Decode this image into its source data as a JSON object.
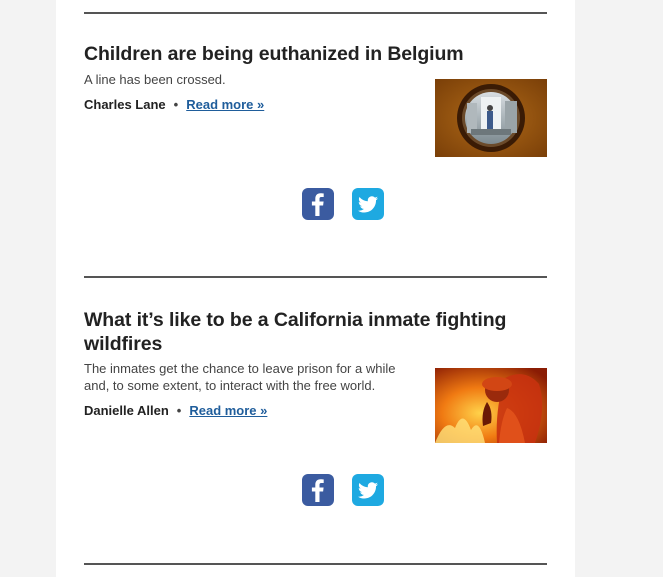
{
  "articles": [
    {
      "headline": "Children are being euthanized in Belgium",
      "dek": "A line has been crossed.",
      "author": "Charles Lane",
      "separator": "•",
      "read_more": "Read more »",
      "image_icon": "hospital-porthole-photo"
    },
    {
      "headline": "What it’s like to be a California inmate fighting wildfires",
      "dek": "The inmates get the chance to leave prison for a while and, to some extent, to interact with the free world.",
      "author": "Danielle Allen",
      "separator": "•",
      "read_more": "Read more »",
      "image_icon": "firefighter-flames-photo"
    }
  ],
  "social": {
    "facebook_icon": "facebook-icon",
    "twitter_icon": "twitter-icon"
  },
  "colors": {
    "link": "#1f5d9b",
    "facebook": "#3b5ba0",
    "twitter": "#1ea9e1"
  }
}
